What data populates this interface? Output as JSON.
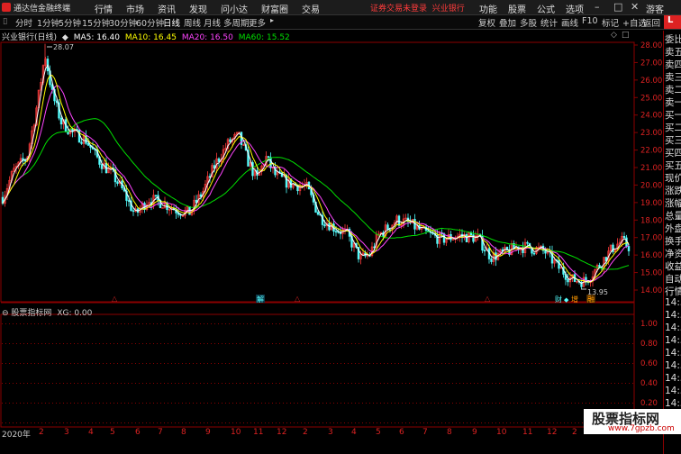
{
  "titlebar": {
    "app_name": "通达信金融终端",
    "menu": [
      "行情",
      "市场",
      "资讯",
      "发现",
      "问小达",
      "财富圈",
      "交易"
    ],
    "status": "证券交易未登录",
    "stock_name": "兴业银行",
    "right_menu": [
      "功能",
      "股票",
      "公式",
      "选项"
    ],
    "user": "游客"
  },
  "toolbar": {
    "periods": [
      "分时",
      "1分钟",
      "5分钟",
      "15分钟",
      "30分钟",
      "60分钟",
      "日线",
      "周线",
      "月线",
      "多周期",
      "更多"
    ],
    "active_period": "日线",
    "tools": [
      "复权",
      "叠加",
      "多股",
      "统计",
      "画线",
      "F10",
      "标记",
      "+自选",
      "返回"
    ]
  },
  "legend": {
    "stock": "兴业银行(日线)",
    "ma5": "MA5: 16.40",
    "ma10": "MA10: 16.45",
    "ma20": "MA20: 16.50",
    "ma60": "MA60: 15.52"
  },
  "colors": {
    "up": "#ff3b3b",
    "down": "#54ffff",
    "ma5": "#ffffff",
    "ma10": "#ffff00",
    "ma20": "#ff44ff",
    "ma60": "#00e000"
  },
  "price_axis": [
    "28.00",
    "27.00",
    "26.00",
    "25.00",
    "24.00",
    "23.00",
    "22.00",
    "21.00",
    "20.00",
    "19.00",
    "18.00",
    "17.00",
    "16.00",
    "15.00",
    "14.00"
  ],
  "annotations": {
    "high": "28.07",
    "low": "13.95"
  },
  "event_markers": [
    "解",
    "财",
    "增",
    "融"
  ],
  "indicator": {
    "title": "股票指标网",
    "value": "XG: 0.00",
    "axis": [
      "1.00",
      "0.80",
      "0.60",
      "0.40",
      "0.20",
      "0.00"
    ]
  },
  "time_axis": [
    "2020年",
    "2",
    "3",
    "4",
    "5",
    "6",
    "7",
    "8",
    "9",
    "10",
    "11",
    "12",
    "2",
    "3",
    "4",
    "5",
    "6",
    "7",
    "8",
    "9",
    "10",
    "11",
    "12",
    "2"
  ],
  "side_panel": {
    "items": [
      "委比",
      "卖五",
      "卖四",
      "卖三",
      "卖二",
      "卖一",
      "买一",
      "买二",
      "买三",
      "买四",
      "买五",
      "现价",
      "涨跌",
      "涨幅",
      "总量",
      "外盘",
      "换手",
      "净资",
      "收益",
      "自动",
      "行情",
      "14:5",
      "14:5",
      "14:5",
      "14:5",
      "14:5",
      "14:5",
      "14:5",
      "14:5",
      "14:5",
      "14:5",
      "14:5"
    ]
  },
  "watermark": {
    "title": "股票指标网",
    "url": "www.7gpzb.com"
  }
}
